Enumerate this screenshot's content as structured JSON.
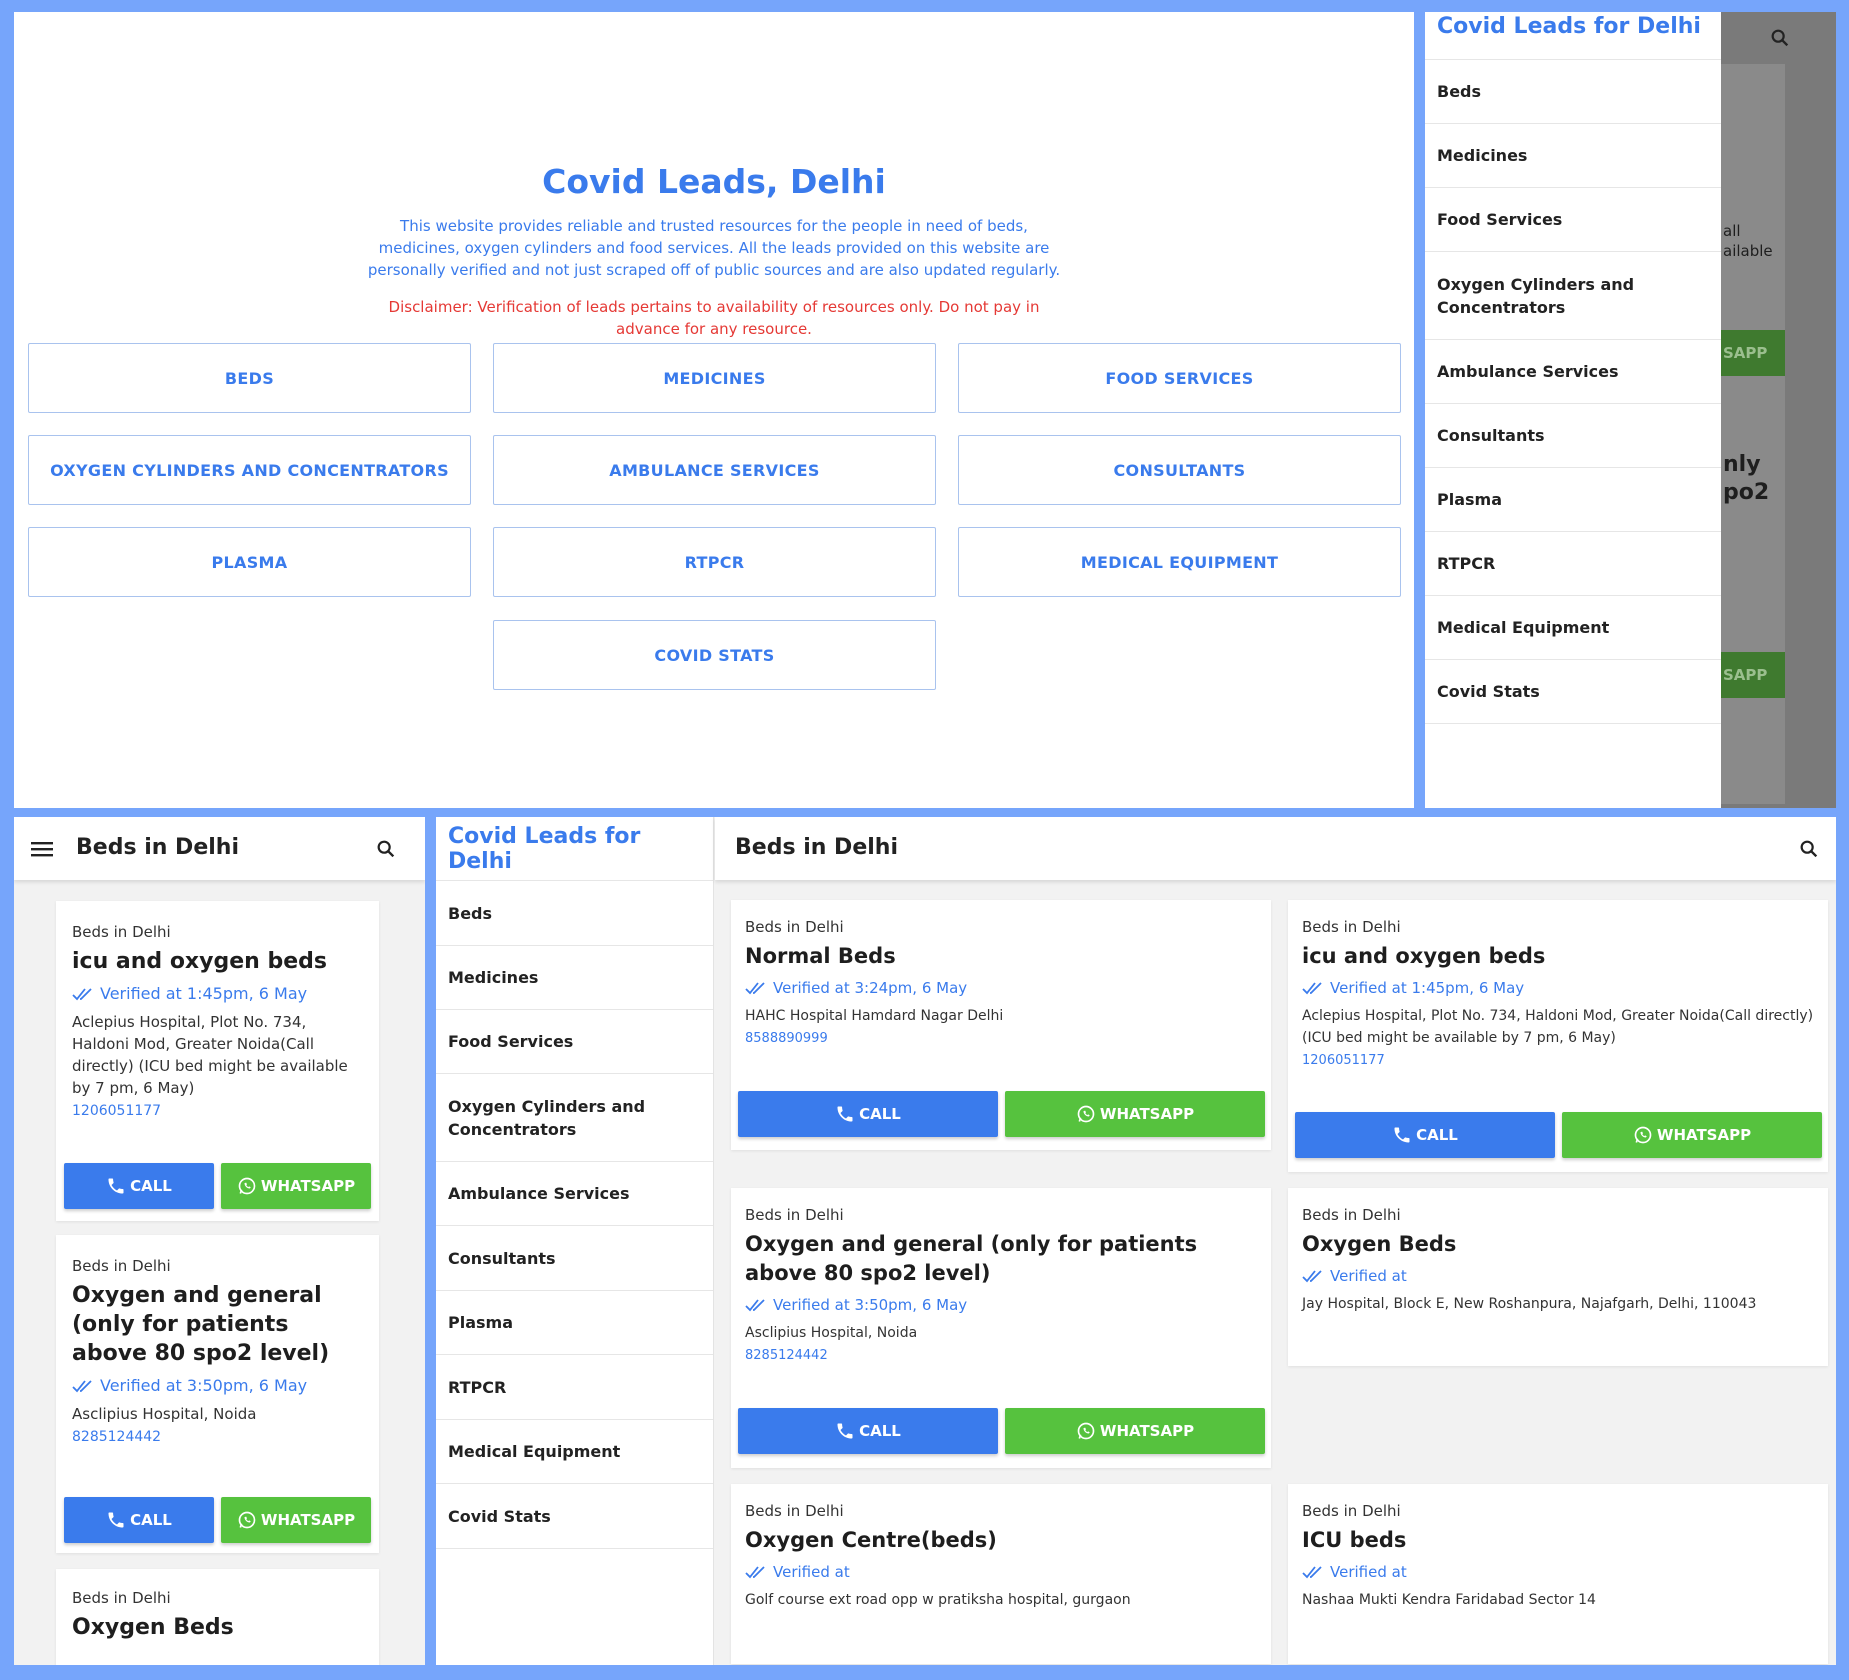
{
  "home": {
    "title": "Covid Leads, Delhi",
    "description": "This website provides reliable and trusted resources for the people in need of beds, medicines, oxygen cylinders and food services. All the leads provided on this website are personally verified and not just scraped off of public sources and are also updated regularly.",
    "disclaimer": "Disclaimer: Verification of leads pertains to availability of resources only. Do not pay in advance for any resource.",
    "categories": [
      "BEDS",
      "MEDICINES",
      "FOOD SERVICES",
      "OXYGEN CYLINDERS AND CONCENTRATORS",
      "AMBULANCE SERVICES",
      "CONSULTANTS",
      "PLASMA",
      "RTPCR",
      "MEDICAL EQUIPMENT",
      "COVID STATS"
    ]
  },
  "drawer": {
    "title": "Covid Leads for Delhi",
    "items": [
      "Beds",
      "Medicines",
      "Food Services",
      "Oxygen Cylinders and Concentrators",
      "Ambulance Services",
      "Consultants",
      "Plasma",
      "RTPCR",
      "Medical Equipment",
      "Covid Stats"
    ],
    "ghost": {
      "t1": "all",
      "t2": "ailable",
      "t3": "SAPP",
      "t4": "nly",
      "t5": "po2",
      "t6": "SAPP"
    }
  },
  "page_title": "Beds in Delhi",
  "buttons": {
    "call": "CALL",
    "whatsapp": "WHATSAPP"
  },
  "icons": {
    "menu": "menu-icon",
    "search": "search-icon",
    "verified": "double-check-icon",
    "phone": "phone-icon",
    "whatsapp": "whatsapp-icon"
  },
  "colors": {
    "accent": "#3a7bec",
    "call": "#3a7bec",
    "whatsapp": "#56c23e",
    "disclaimer": "#e53935",
    "frame": "#76a5fb"
  },
  "mobile_cards": [
    {
      "sub": "Beds in Delhi",
      "title": "icu and oxygen beds",
      "verified": "Verified at 1:45pm, 6 May",
      "address": "Aclepius Hospital, Plot No. 734, Haldoni Mod, Greater Noida(Call directly) (ICU bed might be available by 7 pm, 6 May)",
      "phone": "1206051177"
    },
    {
      "sub": "Beds in Delhi",
      "title": "Oxygen and general (only for patients above 80 spo2 level)",
      "verified": "Verified at 3:50pm, 6 May",
      "address": "Asclipius Hospital, Noida",
      "phone": "8285124442"
    },
    {
      "sub": "Beds in Delhi",
      "title": "Oxygen Beds"
    }
  ],
  "desktop_cards": [
    {
      "sub": "Beds in Delhi",
      "title": "Normal Beds",
      "verified": "Verified at 3:24pm, 6 May",
      "address": "HAHC Hospital Hamdard Nagar Delhi",
      "phone": "8588890999"
    },
    {
      "sub": "Beds in Delhi",
      "title": "icu and oxygen beds",
      "verified": "Verified at 1:45pm, 6 May",
      "address": "Aclepius Hospital, Plot No. 734, Haldoni Mod, Greater Noida(Call directly) (ICU bed might be available by 7 pm, 6 May)",
      "phone": "1206051177"
    },
    {
      "sub": "Beds in Delhi",
      "title": "Oxygen and general (only for patients above 80 spo2 level)",
      "verified": "Verified at 3:50pm, 6 May",
      "address": "Asclipius Hospital, Noida",
      "phone": "8285124442"
    },
    {
      "sub": "Beds in Delhi",
      "title": "Oxygen Beds",
      "verified": "Verified at",
      "address": "Jay Hospital, Block E, New Roshanpura, Najafgarh, Delhi, 110043"
    },
    {
      "sub": "Beds in Delhi",
      "title": "Oxygen Centre(beds)",
      "verified": "Verified at",
      "address": "Golf course ext road opp w pratiksha hospital, gurgaon"
    },
    {
      "sub": "Beds in Delhi",
      "title": "ICU beds",
      "verified": "Verified at",
      "address": "Nashaa Mukti Kendra Faridabad Sector 14"
    }
  ]
}
